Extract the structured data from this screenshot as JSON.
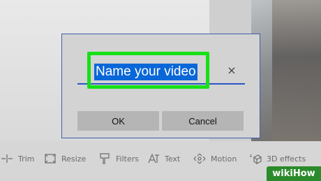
{
  "dialog": {
    "name_value": "Name your video",
    "clear_glyph": "×",
    "ok_label": "OK",
    "cancel_label": "Cancel"
  },
  "toolbar": {
    "items": [
      {
        "label": "Trim",
        "icon": "trim-icon"
      },
      {
        "label": "Resize",
        "icon": "resize-icon"
      },
      {
        "label": "Filters",
        "icon": "filters-icon"
      },
      {
        "label": "Text",
        "icon": "text-icon"
      },
      {
        "label": "Motion",
        "icon": "motion-icon"
      },
      {
        "label": "3D effects",
        "icon": "3d-effects-icon"
      }
    ]
  },
  "watermark": {
    "text": "wikiHow"
  },
  "colors": {
    "accent": "#2b56c7",
    "selection": "#0a67d8",
    "highlight": "#16e016",
    "dialog_border": "#3f5fa8",
    "watermark_bg": "#2b8a2b"
  }
}
